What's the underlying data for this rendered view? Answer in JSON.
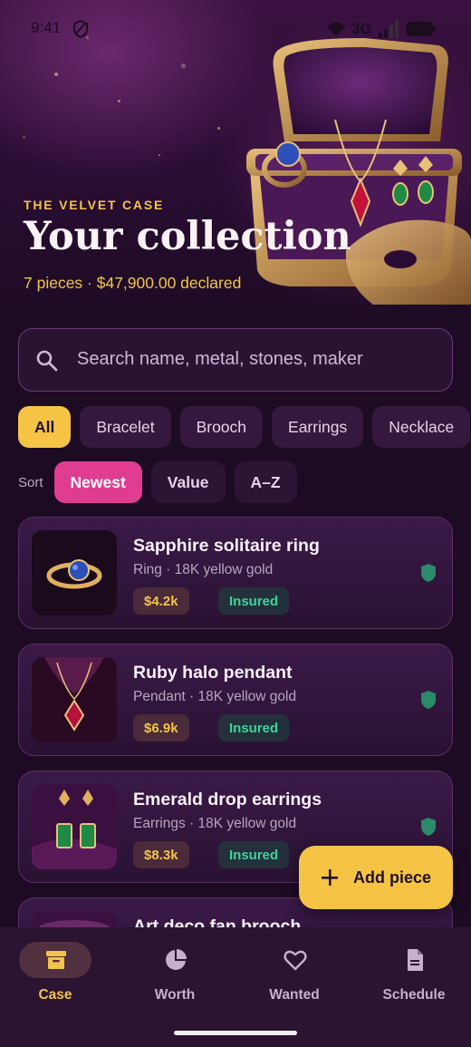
{
  "status": {
    "time": "9:41",
    "network": "3G"
  },
  "hero": {
    "eyebrow": "THE VELVET CASE",
    "title": "Your collection",
    "subtitle": "7 pieces · $47,900.00 declared"
  },
  "search": {
    "placeholder": "Search name, metal, stones, maker"
  },
  "filters": [
    "All",
    "Bracelet",
    "Brooch",
    "Earrings",
    "Necklace"
  ],
  "sort": {
    "label": "Sort",
    "options": [
      "Newest",
      "Value",
      "A–Z"
    ]
  },
  "items": [
    {
      "name": "Sapphire solitaire ring",
      "meta": "Ring · 18K yellow gold",
      "value": "$4.2k",
      "status": "Insured",
      "icon": "shield-icon"
    },
    {
      "name": "Ruby halo pendant",
      "meta": "Pendant · 18K yellow gold",
      "value": "$6.9k",
      "status": "Insured",
      "icon": "shield-icon"
    },
    {
      "name": "Emerald drop earrings",
      "meta": "Earrings · 18K yellow gold",
      "value": "$8.3k",
      "status": "Insured",
      "icon": "shield-icon"
    },
    {
      "name": "Art deco fan brooch"
    }
  ],
  "fab": {
    "label": "Add piece",
    "icon": "plus-icon"
  },
  "nav": [
    {
      "label": "Case",
      "icon": "archive-box-icon"
    },
    {
      "label": "Worth",
      "icon": "pie-chart-icon"
    },
    {
      "label": "Wanted",
      "icon": "heart-icon"
    },
    {
      "label": "Schedule",
      "icon": "document-icon"
    }
  ],
  "colors": {
    "accent": "#f5c445",
    "pink": "#e03d91",
    "insured": "#3fd39a",
    "background": "#1d0b24"
  }
}
